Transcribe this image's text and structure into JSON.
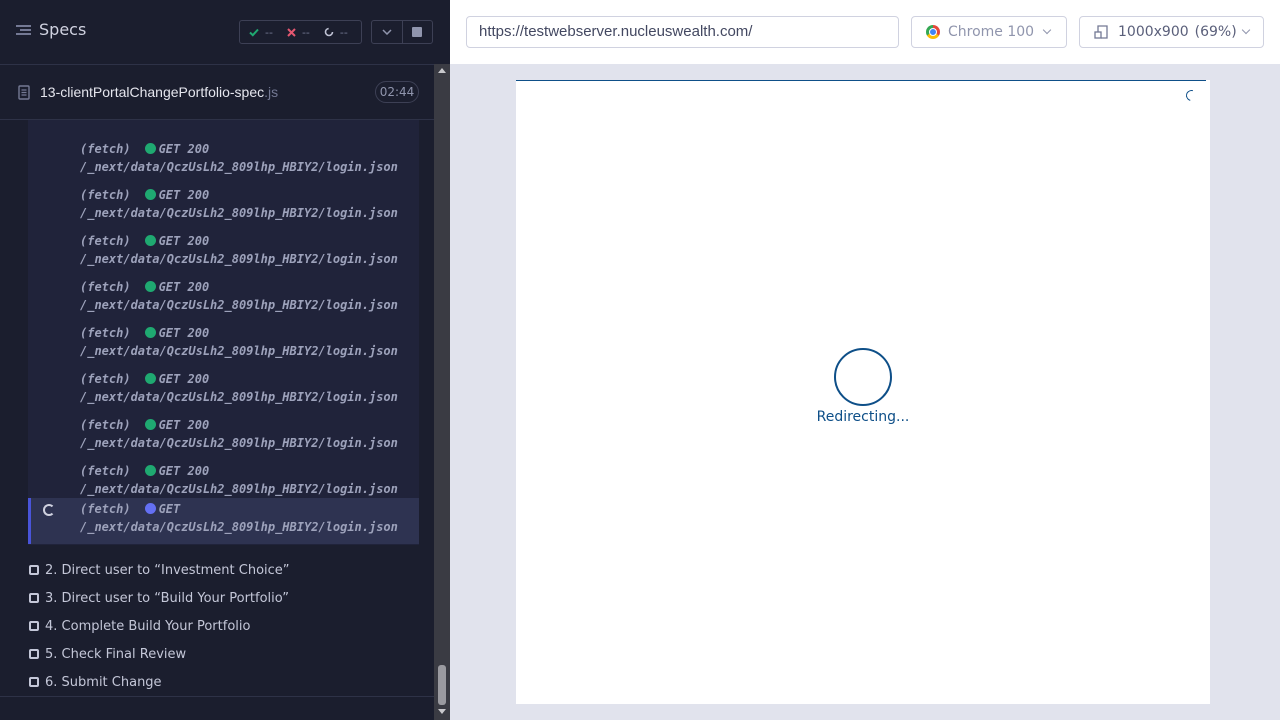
{
  "reporter": {
    "title": "Specs",
    "stats": {
      "passed": "--",
      "failed": "--",
      "pending": "--"
    },
    "spec": {
      "name": "13-clientPortalChangePortfolio-spec",
      "ext": ".js",
      "duration": "02:44"
    },
    "commands": [
      {
        "type": "(fetch)",
        "method": "GET",
        "status": "200",
        "url": "/_next/data/QczUsLh2_809lhp_HBIY2/login.json",
        "dot_color": "#1fa971"
      },
      {
        "type": "(fetch)",
        "method": "GET",
        "status": "200",
        "url": "/_next/data/QczUsLh2_809lhp_HBIY2/login.json",
        "dot_color": "#1fa971"
      },
      {
        "type": "(fetch)",
        "method": "GET",
        "status": "200",
        "url": "/_next/data/QczUsLh2_809lhp_HBIY2/login.json",
        "dot_color": "#1fa971"
      },
      {
        "type": "(fetch)",
        "method": "GET",
        "status": "200",
        "url": "/_next/data/QczUsLh2_809lhp_HBIY2/login.json",
        "dot_color": "#1fa971"
      },
      {
        "type": "(fetch)",
        "method": "GET",
        "status": "200",
        "url": "/_next/data/QczUsLh2_809lhp_HBIY2/login.json",
        "dot_color": "#1fa971"
      },
      {
        "type": "(fetch)",
        "method": "GET",
        "status": "200",
        "url": "/_next/data/QczUsLh2_809lhp_HBIY2/login.json",
        "dot_color": "#1fa971"
      },
      {
        "type": "(fetch)",
        "method": "GET",
        "status": "200",
        "url": "/_next/data/QczUsLh2_809lhp_HBIY2/login.json",
        "dot_color": "#1fa971"
      },
      {
        "type": "(fetch)",
        "method": "GET",
        "status": "200",
        "url": "/_next/data/QczUsLh2_809lhp_HBIY2/login.json",
        "dot_color": "#1fa971"
      },
      {
        "type": "(fetch)",
        "method": "GET",
        "status": "",
        "url": "/_next/data/QczUsLh2_809lhp_HBIY2/login.json",
        "dot_color": "#6470f3",
        "active": true
      }
    ],
    "tests": [
      "2. Direct user to “Investment Choice”",
      "3. Direct user to “Build Your Portfolio”",
      "4. Complete Build Your Portfolio",
      "5. Check Final Review",
      "6. Submit Change"
    ]
  },
  "topbar": {
    "url": "https://testwebserver.nucleuswealth.com/",
    "browser": "Chrome 100",
    "viewport": {
      "size": "1000x900",
      "scale": "(69%)"
    }
  },
  "app": {
    "status": "Redirecting..."
  },
  "colors": {
    "passed": "#1fa971",
    "failed": "#e45770",
    "pending": "#6470f3",
    "brand": "#0e4f88"
  }
}
